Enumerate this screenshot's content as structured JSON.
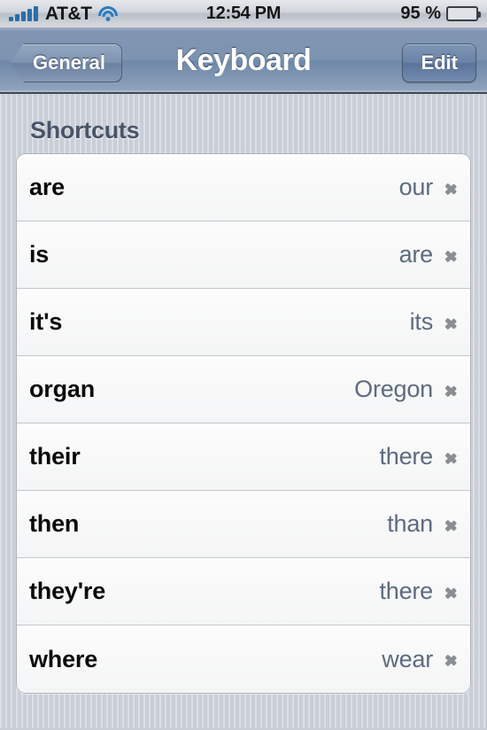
{
  "status_bar": {
    "carrier": "AT&T",
    "time": "12:54 PM",
    "battery_percent": "95 %",
    "signal_bars": 5,
    "signal_icon": "signal-bars-icon",
    "wifi_icon": "wifi-icon",
    "battery_icon": "battery-icon",
    "battery_color": "#57c313"
  },
  "nav_bar": {
    "back_label": "General",
    "title": "Keyboard",
    "edit_label": "Edit"
  },
  "section": {
    "header": "Shortcuts",
    "rows": [
      {
        "shortcut": "are",
        "phrase": "our"
      },
      {
        "shortcut": "is",
        "phrase": "are"
      },
      {
        "shortcut": "it's",
        "phrase": "its"
      },
      {
        "shortcut": "organ",
        "phrase": "Oregon"
      },
      {
        "shortcut": "their",
        "phrase": "there"
      },
      {
        "shortcut": "then",
        "phrase": "than"
      },
      {
        "shortcut": "they're",
        "phrase": "there"
      },
      {
        "shortcut": "where",
        "phrase": "wear"
      }
    ],
    "disclosure_icon": "chevron-right-icon"
  },
  "colors": {
    "detail_text": "#5d6b80",
    "label_text": "#0a0a0a",
    "header_text": "#4a5568",
    "nav_bar": "#7c93b1",
    "background": "#c9ced7"
  }
}
